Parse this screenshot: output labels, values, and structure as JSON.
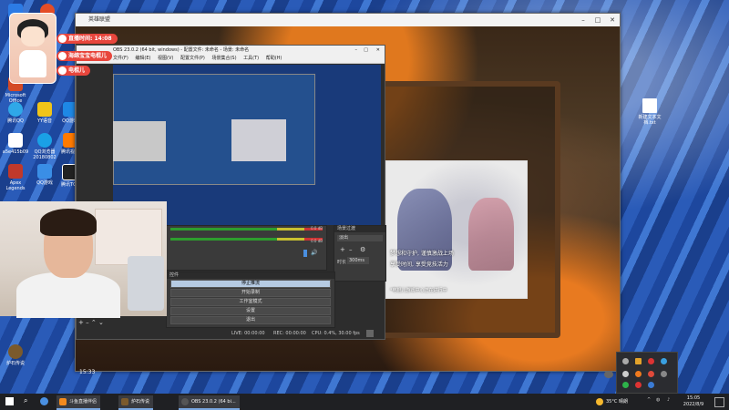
{
  "overlay": {
    "live_time": "直播时间: 14:08",
    "badge_1": "海绵宝宝电棍儿",
    "badge_2": "电棍儿"
  },
  "game_window": {
    "title": "英雄联盟",
    "promo_line_1": "梦想和守护, 谨慎激战上场",
    "promo_line_2": "享受时间, 享受竞技活力",
    "promo_footer": "*电棍儿游戏中心正在进行中"
  },
  "obs": {
    "title": "OBS 23.0.2 (64 bit, windows) - 配置文件: 未命名 - 场景: 未命名",
    "menus": [
      "文件(F)",
      "编辑(E)",
      "视图(V)",
      "配置文件(P)",
      "场景集合(S)",
      "工具(T)",
      "帮助(H)"
    ],
    "transition_title": "场景过渡",
    "transition_value": "淡出",
    "duration_label": "时长",
    "duration_value": "300ms",
    "mixer_db_1": "0.0 dB",
    "mixer_db_2": "0.0 dB",
    "controls_title": "控件",
    "controls": [
      "停止推流",
      "开始录制",
      "工作室模式",
      "设置",
      "退出"
    ],
    "status": {
      "live": "LIVE: 00:00:00",
      "rec": "REC: 00:00:00",
      "cpu": "CPU: 0.4%, 30.00 fps"
    }
  },
  "projector_clock": "15:33",
  "desktop_icons_left": [
    {
      "label": "Microsoft Office"
    },
    {
      "label": "腾讯QQ"
    },
    {
      "label": "YY语音"
    },
    {
      "label": "QQ游戏"
    },
    {
      "label": "a5e415b09"
    },
    {
      "label": "QQ浏览器 20180802"
    },
    {
      "label": "腾讯视频"
    },
    {
      "label": "Apex Legends"
    },
    {
      "label": "QQ游戏"
    },
    {
      "label": "腾讯TGP"
    }
  ],
  "desktop_icon_bottom": {
    "label": "炉石传说"
  },
  "desktop_icon_right": {
    "label": "新建文本文档.txt"
  },
  "taskbar": {
    "apps": [
      {
        "label": "斗鱼直播伴侣"
      },
      {
        "label": "炉石传说"
      },
      {
        "label": "OBS 23.0.2 (64 bi..."
      }
    ],
    "weather": "35°C  晴朗",
    "time": "15:05",
    "date": "2022/8/9"
  },
  "colors": {
    "overlay_pill": "#e8463c",
    "desktop_blue": "#1a3f8c",
    "obs_bg": "#2d2d2d",
    "taskbar_bg": "#1f2023"
  }
}
